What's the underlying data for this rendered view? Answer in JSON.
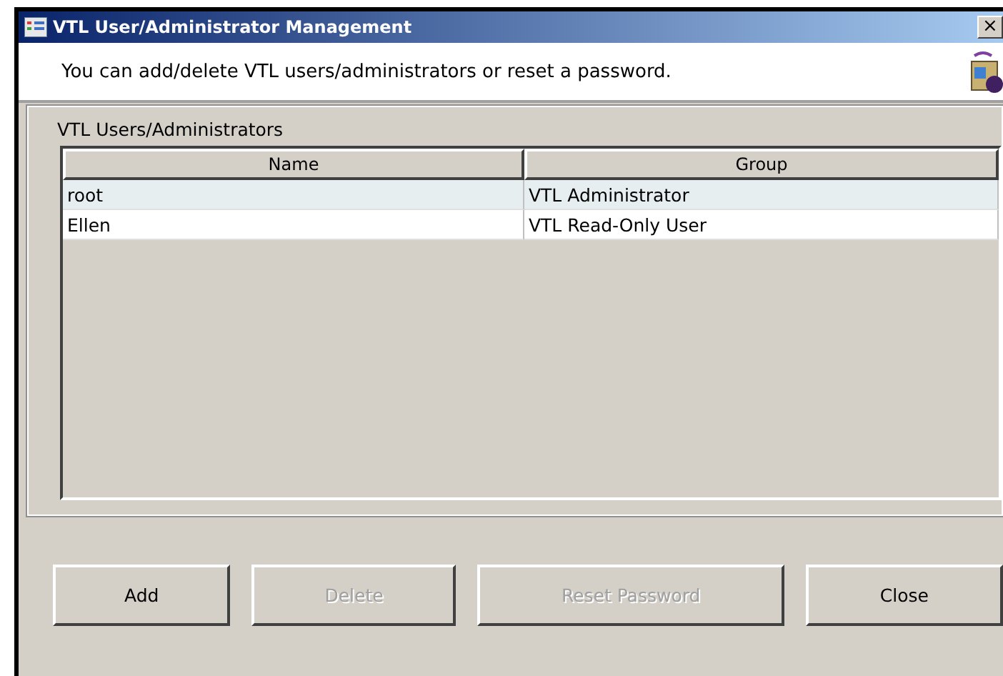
{
  "window": {
    "title": "VTL User/Administrator Management",
    "close": "×"
  },
  "header": {
    "message": "You can add/delete VTL users/administrators or reset a password."
  },
  "group": {
    "label": "VTL Users/Administrators"
  },
  "table": {
    "columns": [
      "Name",
      "Group"
    ],
    "rows": [
      {
        "cells": [
          "root",
          "VTL Administrator"
        ],
        "selected": true
      },
      {
        "cells": [
          "Ellen",
          "VTL Read-Only User"
        ],
        "selected": false
      }
    ]
  },
  "buttons": [
    {
      "label": "Add",
      "disabled": false
    },
    {
      "label": "Delete",
      "disabled": true
    },
    {
      "label": "Reset Password",
      "disabled": true
    },
    {
      "label": "Close",
      "disabled": false
    }
  ]
}
